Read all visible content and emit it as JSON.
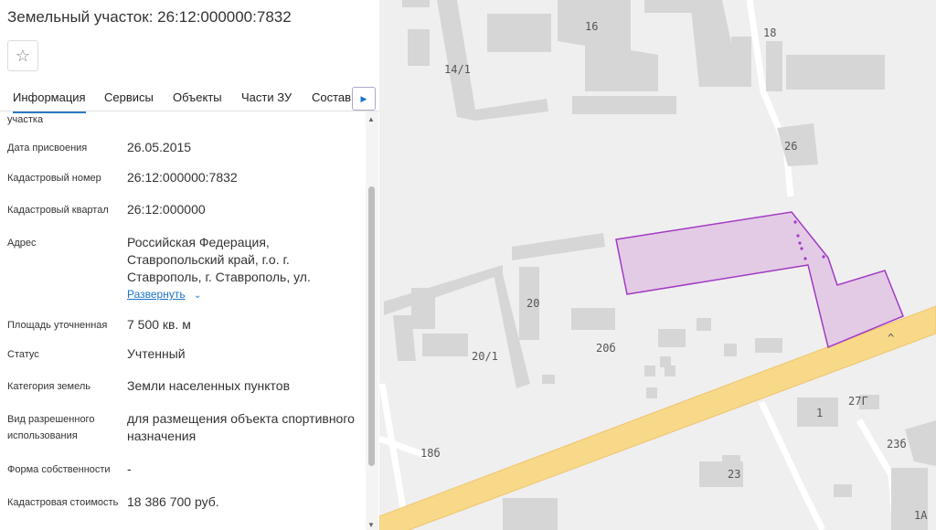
{
  "panel": {
    "title": "Земельный участок: 26:12:000000:7832",
    "favorite_icon": "star-outline-icon",
    "tabs": [
      "Информация",
      "Сервисы",
      "Объекты",
      "Части ЗУ",
      "Состав"
    ],
    "active_tab": "Информация",
    "tab_next_icon": "chevron-right-icon"
  },
  "info": {
    "partial_label": "участка",
    "rows": [
      {
        "label": "Дата присвоения",
        "value": "26.05.2015"
      },
      {
        "label": "Кадастровый номер",
        "value": "26:12:000000:7832"
      },
      {
        "label": "Кадастровый квартал",
        "value": "26:12:000000"
      },
      {
        "label": "Адрес",
        "value": "Российская Федерация, Ставропольский край, г.о. г. Ставрополь, г. Ставрополь, ул."
      },
      {
        "label": "Площадь уточненная",
        "value": "7 500 кв. м"
      },
      {
        "label": "Статус",
        "value": "Учтенный"
      },
      {
        "label": "Категория земель",
        "value": "Земли населенных пунктов"
      },
      {
        "label": "Вид разрешенного использования",
        "value": "для размещения объекта спортивного назначения"
      },
      {
        "label": "Форма собственности",
        "value": "-"
      },
      {
        "label": "Кадастровая стоимость",
        "value": "18 386 700 руб."
      }
    ],
    "expand_label": "Развернуть"
  },
  "map": {
    "labels": [
      "16",
      "14/1",
      "18",
      "26",
      "20",
      "20/1",
      "20б",
      "27Г",
      "1",
      "23б",
      "18б",
      "23",
      "1А"
    ],
    "parcel_fill": "#e0c4e3",
    "parcel_stroke": "#a23ac4",
    "road_color": "#f8d98a",
    "building_color": "#d6d6d6"
  }
}
